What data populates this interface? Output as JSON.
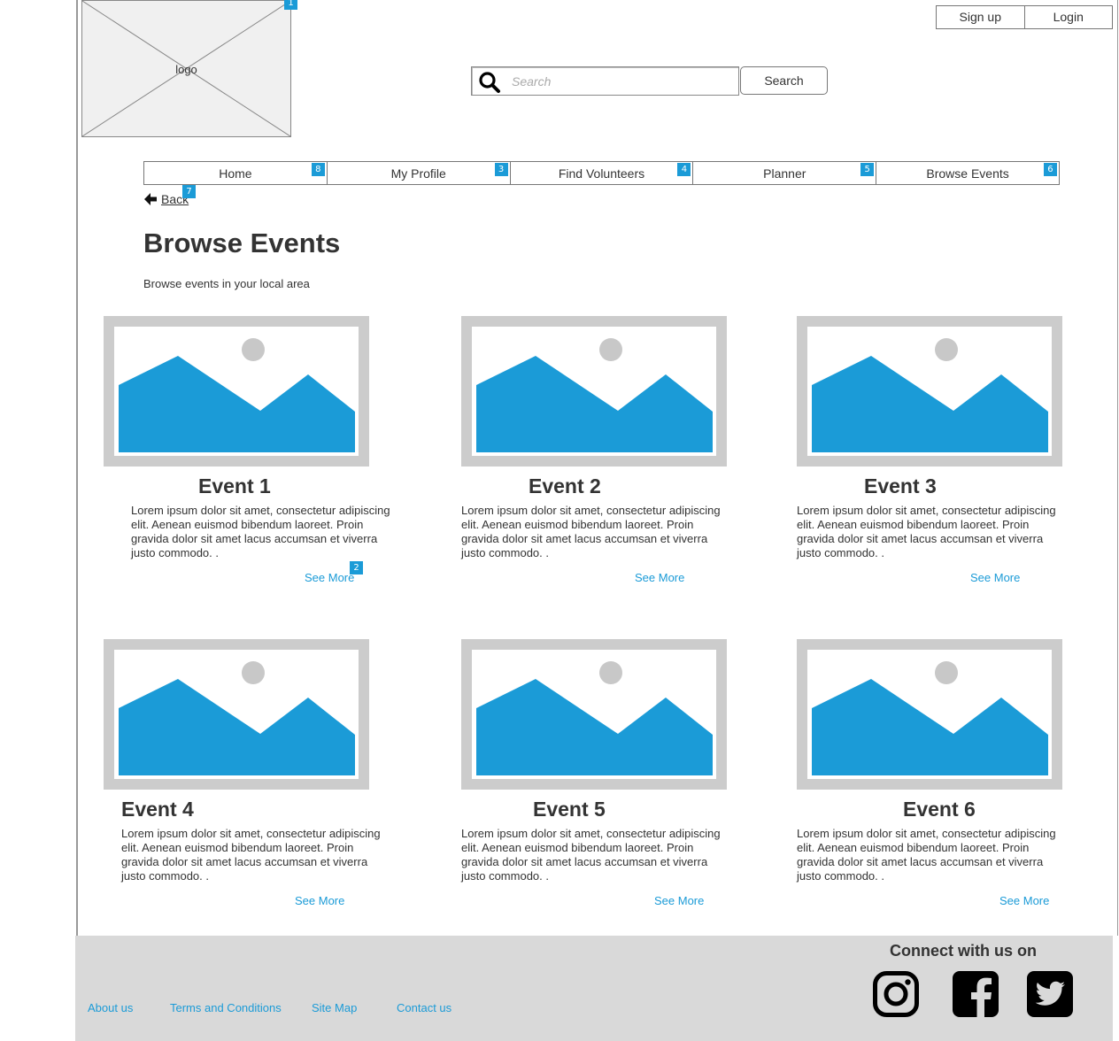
{
  "logo": {
    "text": "logo",
    "badge": "1"
  },
  "auth": {
    "signup_label": "Sign up",
    "login_label": "Login"
  },
  "search": {
    "placeholder": "Search",
    "button_label": "Search",
    "icon": "search-icon"
  },
  "nav": {
    "items": [
      {
        "label": "Home",
        "badge": "8"
      },
      {
        "label": "My Profile",
        "badge": "3"
      },
      {
        "label": "Find Volunteers",
        "badge": "4"
      },
      {
        "label": "Planner",
        "badge": "5"
      },
      {
        "label": "Browse Events",
        "badge": "6"
      }
    ]
  },
  "back": {
    "label": "Back",
    "badge": "7",
    "icon": "arrow-left-icon"
  },
  "page": {
    "title": "Browse Events",
    "subtitle": "Browse events in your local area"
  },
  "events": [
    {
      "title": "Event 1",
      "description": "Lorem ipsum dolor sit amet, consectetur adipiscing elit. Aenean euismod bibendum laoreet. Proin gravida dolor sit amet lacus accumsan et viverra justo commodo. .",
      "more_label": "See More",
      "badge": "2"
    },
    {
      "title": "Event 2",
      "description": "Lorem ipsum dolor sit amet, consectetur adipiscing elit. Aenean euismod bibendum laoreet. Proin gravida dolor sit amet lacus accumsan et viverra justo commodo. .",
      "more_label": "See More"
    },
    {
      "title": "Event 3",
      "description": "Lorem ipsum dolor sit amet, consectetur adipiscing elit. Aenean euismod bibendum laoreet. Proin gravida dolor sit amet lacus accumsan et viverra justo commodo. .",
      "more_label": "See More"
    },
    {
      "title": "Event 4",
      "description": "Lorem ipsum dolor sit amet, consectetur adipiscing elit. Aenean euismod bibendum laoreet. Proin gravida dolor sit amet lacus accumsan et viverra justo commodo. .",
      "more_label": "See More"
    },
    {
      "title": "Event 5",
      "description": "Lorem ipsum dolor sit amet, consectetur adipiscing elit. Aenean euismod bibendum laoreet. Proin gravida dolor sit amet lacus accumsan et viverra justo commodo. .",
      "more_label": "See More"
    },
    {
      "title": "Event 6",
      "description": "Lorem ipsum dolor sit amet, consectetur adipiscing elit. Aenean euismod bibendum laoreet. Proin gravida dolor sit amet lacus accumsan et viverra justo commodo. .",
      "more_label": "See More"
    }
  ],
  "footer": {
    "links": [
      "About us",
      "Terms and Conditions",
      "Site Map",
      "Contact us"
    ],
    "connect_label": "Connect with us on",
    "social_icons": [
      "instagram-icon",
      "facebook-icon",
      "twitter-icon"
    ]
  },
  "colors": {
    "accent": "#1b9bd7",
    "image_frame": "#cccccc",
    "footer_bg": "#d9d9d9"
  }
}
